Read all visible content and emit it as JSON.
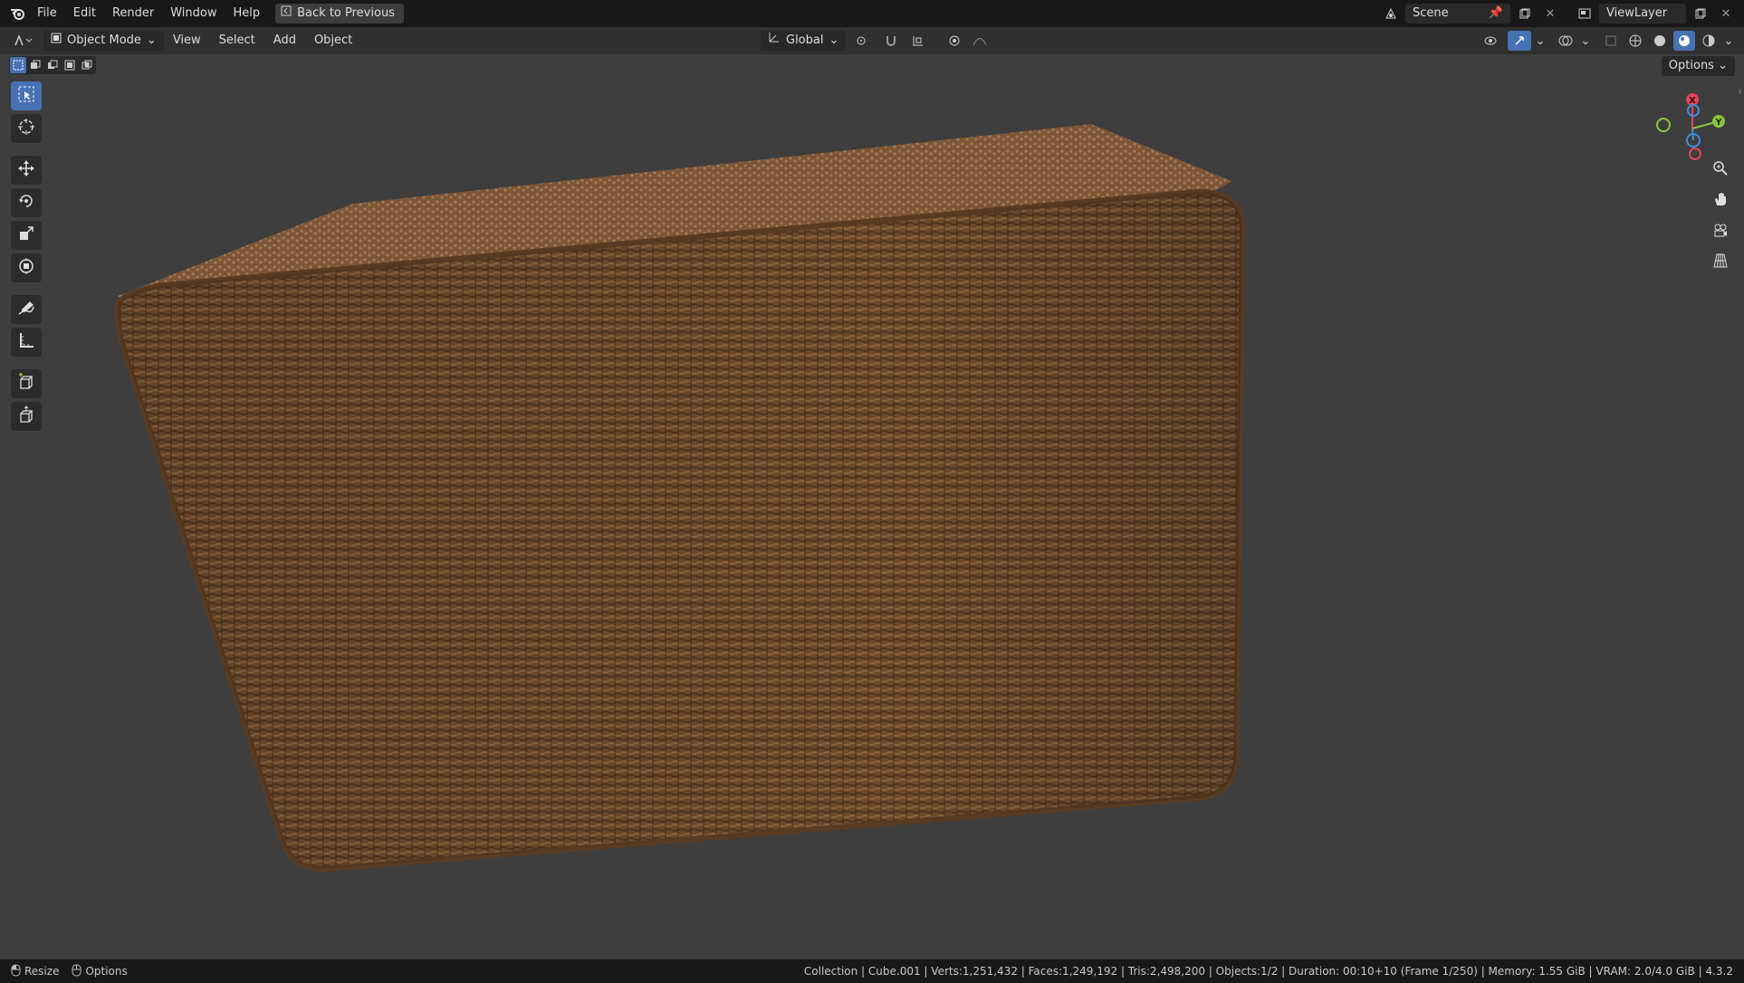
{
  "topbar": {
    "menus": [
      "File",
      "Edit",
      "Render",
      "Window",
      "Help"
    ],
    "back_label": "Back to Previous",
    "scene": "Scene",
    "view_layer": "ViewLayer"
  },
  "header": {
    "mode": "Object Mode",
    "menus": [
      "View",
      "Select",
      "Add",
      "Object"
    ],
    "orientation": "Global",
    "options": "Options"
  },
  "viewport": {
    "gizmo_axes": [
      "X",
      "Y",
      "Z"
    ],
    "object_material": "wicker-weave",
    "colors": {
      "background": "#3e3e3e",
      "wicker": "#6e4a2c",
      "accent": "#4772b3",
      "x_axis": "#e0465e",
      "y_axis": "#8bc53f",
      "z_axis": "#3d8fe0"
    }
  },
  "toolbar": {
    "tools": [
      "select-box-icon",
      "cursor-icon",
      "move-icon",
      "rotate-icon",
      "scale-icon",
      "transform-icon",
      "annotate-icon",
      "measure-icon",
      "add-cube-icon",
      "extrude-icon"
    ]
  },
  "status": {
    "left_action": "Resize",
    "left_options": "Options",
    "info": "Collection | Cube.001 | Verts:1,251,432 | Faces:1,249,192 | Tris:2,498,200 | Objects:1/2 | Duration: 00:10+10 (Frame 1/250) | Memory: 1.55 GiB | VRAM: 2.0/4.0 GiB | 4.3.2"
  }
}
